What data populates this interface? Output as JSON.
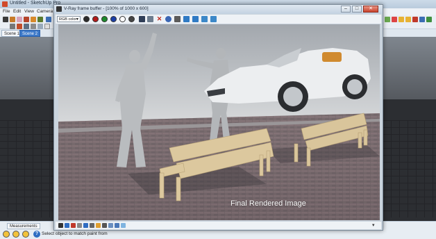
{
  "sketchup": {
    "title": "Untitled - SketchUp Pro",
    "menu": [
      "File",
      "Edit",
      "View",
      "Camera"
    ],
    "scenes": [
      {
        "label": "Scene 1",
        "active": false
      },
      {
        "label": "Scene 2",
        "active": true
      }
    ],
    "measurements_label": "Measurements",
    "status_text": "Select object to match paint from",
    "help_icon": "?"
  },
  "vray_frame_buffer": {
    "title": "V-Ray frame buffer - [100% of 1000 x 600]",
    "channel": "RGB color",
    "window_buttons": {
      "minimize": "–",
      "maximize": "□",
      "close": "✕"
    },
    "render_caption": "Final Rendered Image"
  },
  "colors": {
    "accent_blue": "#3c79c9",
    "render_background": "#8f959c",
    "bench_wood": "#dcc89e"
  },
  "icons": [
    "arrow-icon",
    "pencil-icon",
    "eraser-icon",
    "paint-icon",
    "orbit-icon",
    "save-icon",
    "close-icon",
    "help-icon"
  ]
}
